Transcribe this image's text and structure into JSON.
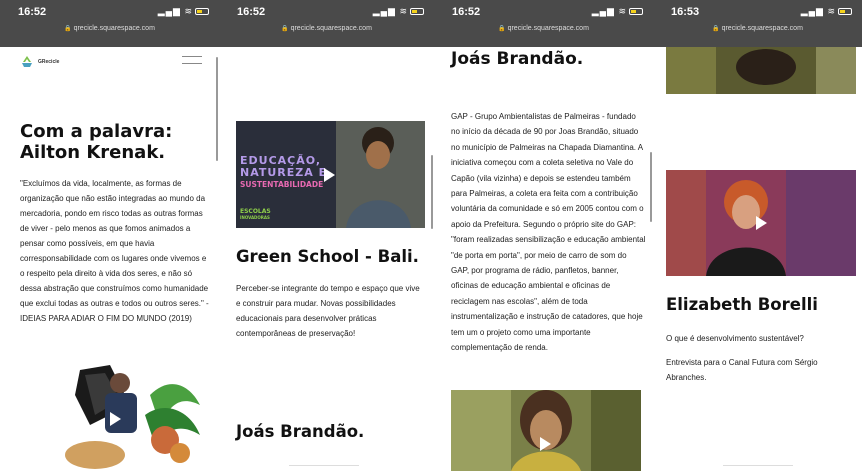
{
  "phone1": {
    "status": {
      "time": "16:52",
      "url": "qrecicle.squarespace.com"
    },
    "brand": "GRecicle",
    "heading_line1": "Com a palavra:",
    "heading_line2": "Ailton Krenak.",
    "quote": "\"Excluímos da vida, localmente, as formas de organização que não estão integradas ao mundo da mercadoria, pondo em risco todas as outras formas de viver - pelo menos as que fomos animados a pensar como possíveis, em que havia corresponsabilidade com os lugares onde vivemos e o respeito pela direito à vida dos seres, e não só dessa abstração que construímos como humanidade que exclui todas as outras e todos ou outros seres.\" - IDEIAS PARA ADIAR O FIM DO MUNDO (2019)"
  },
  "phone2": {
    "status": {
      "time": "16:52",
      "url": "qrecicle.squarespace.com"
    },
    "video_title_line1": "EDUCAÇÃO,",
    "video_title_line2": "NATUREZA E",
    "video_title_line3": "SUSTENTABILIDADE",
    "video_badge_line1": "ESCOLAS",
    "video_badge_line2": "INOVADORAS",
    "heading": "Green School - Bali.",
    "text": "Perceber-se integrante do tempo e espaço que vive e construir para mudar. Novas possibilidades educacionais para desenvolver práticas contemporâneas de preservação!",
    "next_heading": "Joás Brandão."
  },
  "phone3": {
    "status": {
      "time": "16:52",
      "url": "qrecicle.squarespace.com"
    },
    "heading": "Joás Brandão.",
    "text": "GAP - Grupo Ambientalistas de Palmeiras - fundado no início da década de 90 por Joas Brandão, situado no município de Palmeiras na Chapada Diamantina. A iniciativa começou com a coleta seletiva no Vale do Capão (vila vizinha) e depois se estendeu também para Palmeiras, a coleta era feita com a contribuição voluntária da comunidade e só em 2005 contou com o apoio da Prefeitura. Segundo o próprio site do GAP: \"foram realizadas sensibilização e educação ambiental \"de porta em porta\", por meio de carro de som do GAP, por programa de rádio, panfletos, banner, oficinas de educação ambiental e oficinas de reciclagem nas escolas\", além de toda instrumentalização e instrução de catadores, que hoje tem um o projeto como uma importante complementação de renda."
  },
  "phone4": {
    "status": {
      "time": "16:53",
      "url": "qrecicle.squarespace.com"
    },
    "heading": "Elizabeth Borelli",
    "question": "O que é desenvolvimento sustentável?",
    "text": "Entrevista para o Canal Futura com Sérgio Abranches."
  },
  "colors": {
    "statusbar": "#4a4a4a",
    "video_title_accent": "#9c7cd6",
    "sustentabilidade": "#e05ea8",
    "badge_green": "#8fd04a"
  }
}
